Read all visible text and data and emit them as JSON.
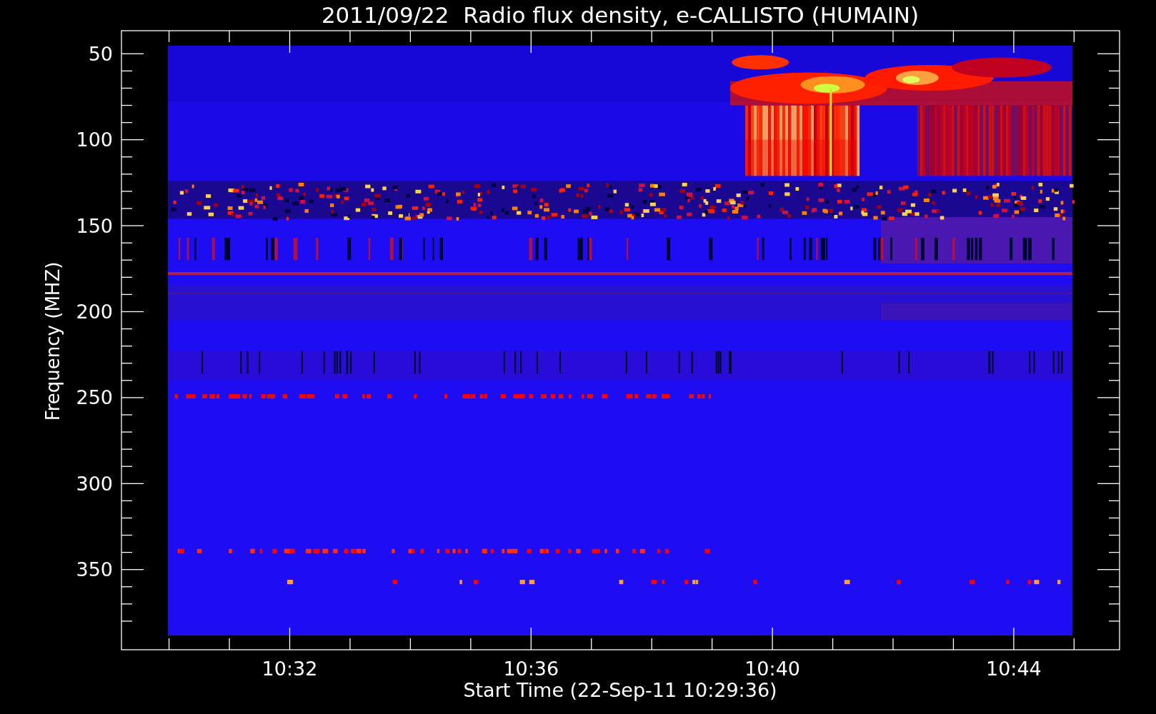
{
  "title": "2011/09/22  Radio flux density, e-CALLISTO (HUMAIN)",
  "plot": {
    "ylabel": "Frequency (MHZ)",
    "xlabel": "Start Time (22-Sep-11 10:29:36)",
    "yticks": [
      "50",
      "100",
      "150",
      "200",
      "250",
      "300",
      "350"
    ],
    "xticks": [
      "10:32",
      "10:36",
      "10:40",
      "10:44"
    ]
  }
}
